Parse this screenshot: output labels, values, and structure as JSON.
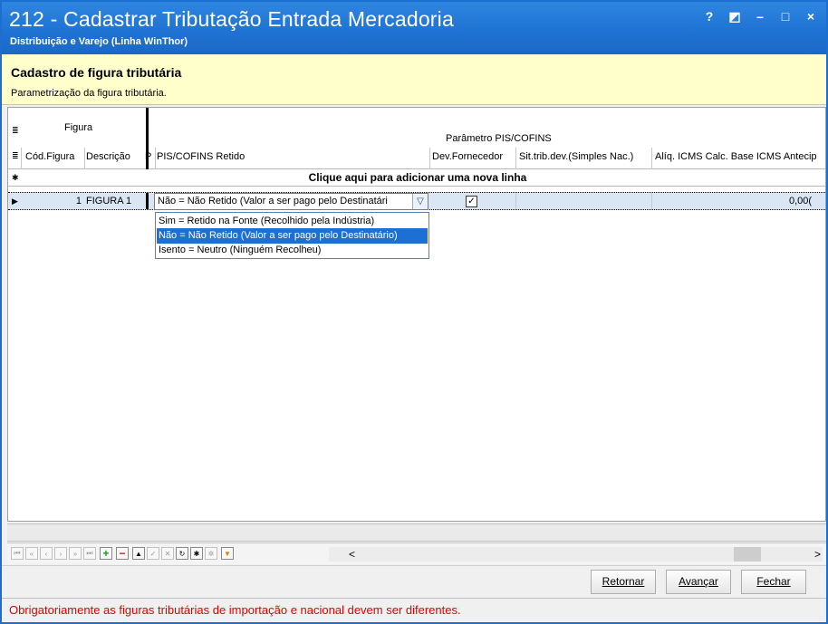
{
  "window": {
    "title": "212 - Cadastrar Tributação Entrada Mercadoria",
    "subtitle": "Distribuição e Varejo (Linha WinThor)",
    "controls": [
      "?",
      "◩",
      "–",
      "□",
      "×"
    ]
  },
  "header": {
    "title": "Cadastro de figura tributária",
    "subtitle": "Parametrização da figura tributária."
  },
  "grid": {
    "group_figura": "Figura",
    "group_pis": "Parâmetro PIS/COFINS",
    "columns": [
      "Cód.Figura",
      "Descrição",
      "P",
      "PIS/COFINS Retido",
      "Dev.Fornecedor",
      "Sit.trib.dev.(Simples Nac.)",
      "Alíq. ICMS Calc. Base ICMS Antecip"
    ],
    "new_row_text": "Clique aqui para adicionar uma nova linha",
    "rows": [
      {
        "cod_figura": "1",
        "descricao": "FIGURA 1",
        "pis_cofins_retido": "Não = Não Retido (Valor a ser pago pelo Destinatári",
        "dev_fornecedor_checked": true,
        "aliq_icms": "0,00("
      }
    ],
    "dropdown_options": [
      "Sim = Retido na Fonte (Recolhido pela Indústria)",
      "Não = Não Retido (Valor a ser pago pelo Destinatário)",
      "Isento = Neutro (Ninguém Recolheu)"
    ],
    "selected_option_index": 1
  },
  "navbar": {
    "scroll_left": "<",
    "scroll_right": ">"
  },
  "buttons": {
    "retornar": "Retornar",
    "avancar": "Avançar",
    "fechar": "Fechar"
  },
  "status": {
    "message": "Obrigatoriamente as figuras tributárias de importação e nacional devem ser diferentes.",
    "color": "#e00000"
  },
  "colors": {
    "titlebar": "#1f73d4",
    "header_panel": "#ffffcc",
    "selected_option": "#1e6fd4"
  }
}
